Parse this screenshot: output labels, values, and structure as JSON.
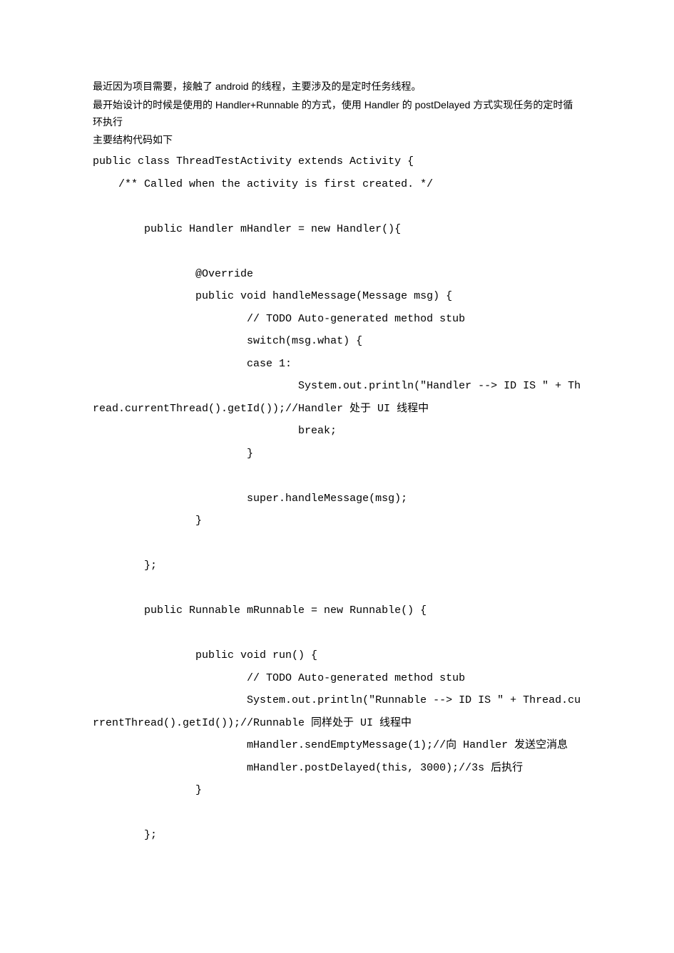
{
  "prose": {
    "p1": "  最近因为项目需要，接触了 android 的线程，主要涉及的是定时任务线程。",
    "p2": "最开始设计的时候是使用的 Handler+Runnable 的方式，使用 Handler 的 postDelayed 方式实现任务的定时循环执行",
    "p3": "主要结构代码如下"
  },
  "code_lines": [
    "public class ThreadTestActivity extends Activity {",
    "    /** Called when the activity is first created. */",
    "",
    "        public Handler mHandler = new Handler(){",
    "",
    "                @Override",
    "                public void handleMessage(Message msg) {",
    "                        // TODO Auto-generated method stub",
    "                        switch(msg.what) {",
    "                        case 1:",
    "                                System.out.println(\"Handler --> ID IS \" + Thread.currentThread().getId());//Handler 处于 UI 线程中",
    "                                break;",
    "                        }",
    "",
    "                        super.handleMessage(msg);",
    "                }",
    "",
    "        };",
    "",
    "        public Runnable mRunnable = new Runnable() {",
    "",
    "                public void run() {",
    "                        // TODO Auto-generated method stub",
    "                        System.out.println(\"Runnable --> ID IS \" + Thread.currentThread().getId());//Runnable 同样处于 UI 线程中",
    "                        mHandler.sendEmptyMessage(1);//向 Handler 发送空消息",
    "                        mHandler.postDelayed(this, 3000);//3s 后执行",
    "                }",
    "",
    "        };"
  ]
}
